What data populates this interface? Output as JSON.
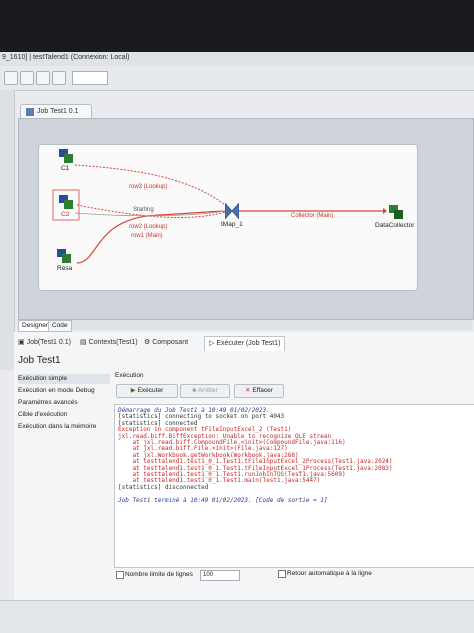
{
  "window": {
    "title": "9_1610] | testTalend1 (Connexion: Local)"
  },
  "editor": {
    "tab_label": "Job Test1 0.1"
  },
  "canvas": {
    "components": [
      {
        "id": "c1",
        "label": "C1"
      },
      {
        "id": "c2",
        "label": "C2"
      },
      {
        "id": "resa",
        "label": "Résa"
      },
      {
        "id": "tmap",
        "label": "tMap_1"
      },
      {
        "id": "collector",
        "label": "DataCollector"
      }
    ],
    "links": {
      "row3": "row3 (Lookup)",
      "starting": "Starting",
      "row2": "row2 (Lookup)",
      "row1": "row1 (Main)",
      "collector": "Collector (Main)"
    }
  },
  "design_tabs": [
    "Designer",
    "Code"
  ],
  "run_tabs": {
    "job": "Job(Test1 0.1)",
    "contexts": "Contexts(Test1)",
    "component": "Composant",
    "run": "Exécuter (Job Test1)"
  },
  "job_title": "Job Test1",
  "left_menu": [
    "Exécution simple",
    "Exécution en mode Debug",
    "Paramètres avancés",
    "Cible d'exécution",
    "Exécution dans la mémoire"
  ],
  "section_title": "Exécution",
  "buttons": {
    "run": "Exécuter",
    "stop": "Arrêter",
    "clear": "Effacer"
  },
  "console_lines": [
    {
      "t": "Démarrage du Job Test1 à 10:49 01/02/2023.",
      "c": "blue"
    },
    {
      "t": "[statistics] connecting to socket on port 4043",
      "c": "dark"
    },
    {
      "t": "[statistics] connected",
      "c": "dark"
    },
    {
      "t": "Exception in component tFileInputExcel_2 (Test1)",
      "c": "red"
    },
    {
      "t": "jxl.read.biff.BiffException: Unable to recognize OLE strean",
      "c": "red"
    },
    {
      "t": "    at jxl.read.biff.CompoundFile.<init>(CompoundFile.java:116)",
      "c": "red"
    },
    {
      "t": "    at jxl.read.biff.File.<init>(File.java:127)",
      "c": "red"
    },
    {
      "t": "    at jxl.Workbook.getWorkbook(Workbook.java:268)",
      "c": "red"
    },
    {
      "t": "    at testtalend1.test1_0_1.Test1.tFileInputExcel_2Process(Test1.java:2024)",
      "c": "red"
    },
    {
      "t": "    at testtalend1.test1_0_1.Test1.tFileInputExcel_1Process(Test1.java:2083)",
      "c": "red"
    },
    {
      "t": "    at testtalend1.test1_0_1.Test1.runJobInTOS(Test1.java:5609)",
      "c": "red"
    },
    {
      "t": "    at testtalend1.test1_0_1.Test1.main(Test1.java:5447)",
      "c": "red"
    },
    {
      "t": "[statistics] disconnected",
      "c": "dark"
    },
    {
      "t": "",
      "c": "dark"
    },
    {
      "t": "Job Test1 terminé à 10:49 01/02/2023. [Code de sortie = 1]",
      "c": "blue"
    }
  ],
  "options": {
    "line_limit_label": "Nombre limite de lignes",
    "line_limit_value": "100",
    "wrap_label": "Retour automatique à la ligne"
  },
  "colors": {
    "link": "#d9463a",
    "accent": "#2e7d32"
  }
}
